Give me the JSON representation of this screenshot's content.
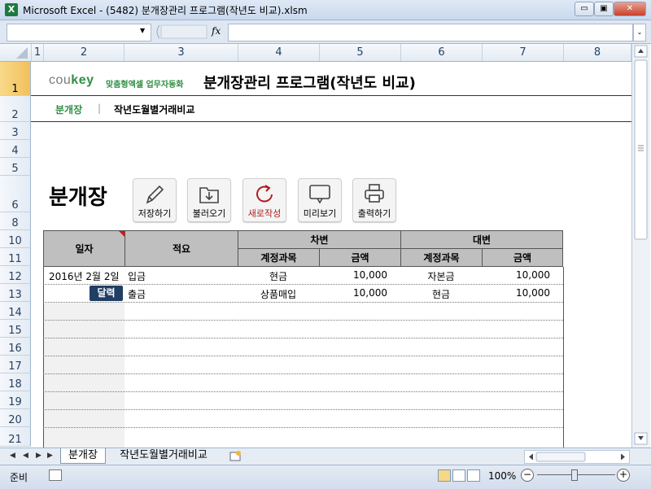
{
  "window": {
    "title": "Microsoft Excel - (5482) 분개장관리 프로그램(작년도 비교).xlsm",
    "app_icon": "X",
    "minimize_icon": "▭",
    "restore_icon": "▣",
    "close_icon": "✕"
  },
  "formula_bar": {
    "fx_label": "fx",
    "name_box_value": "",
    "formula_value": ""
  },
  "columns": [
    "1",
    "2",
    "3",
    "4",
    "5",
    "6",
    "7",
    "8"
  ],
  "rows": [
    "1",
    "2",
    "3",
    "4",
    "5",
    "6",
    "8",
    "10",
    "11",
    "12",
    "13",
    "14",
    "15",
    "16",
    "17",
    "18",
    "19",
    "20",
    "21"
  ],
  "header": {
    "brand_prefix": "cou",
    "brand_suffix": "key",
    "brand_tagline": "맞춤형엑셀 업무자동화",
    "program_title": "분개장관리 프로그램(작년도 비교)"
  },
  "nav": {
    "item1": "분개장",
    "separator": "|",
    "item2": "작년도월별거래비교"
  },
  "sheet_heading": "분개장",
  "toolbar": {
    "save": "저장하기",
    "load": "불러오기",
    "new": "새로작성",
    "preview": "미리보기",
    "print": "출력하기"
  },
  "table": {
    "col_date": "일자",
    "col_summary": "적요",
    "debit": "차변",
    "credit": "대변",
    "account": "계정과목",
    "amount": "금액",
    "rows": [
      {
        "date": "2016년 2월 2일",
        "summary": "입금",
        "debit_account": "현금",
        "debit_amount": "10,000",
        "credit_account": "자본금",
        "credit_amount": "10,000"
      },
      {
        "date": "",
        "summary": "출금",
        "debit_account": "상품매입",
        "debit_amount": "10,000",
        "credit_account": "현금",
        "credit_amount": "10,000"
      }
    ],
    "calendar_button": "달력"
  },
  "tabs": {
    "sheet1": "분개장",
    "sheet2": "작년도월별거래비교"
  },
  "status": {
    "ready": "준비",
    "zoom": "100%",
    "zoom_out": "−",
    "zoom_in": "+"
  },
  "colors": {
    "brand_green": "#2f8f43",
    "header_gray": "#bfbfbf",
    "calendar_navy": "#1f3f64",
    "new_red": "#b11d1d"
  }
}
